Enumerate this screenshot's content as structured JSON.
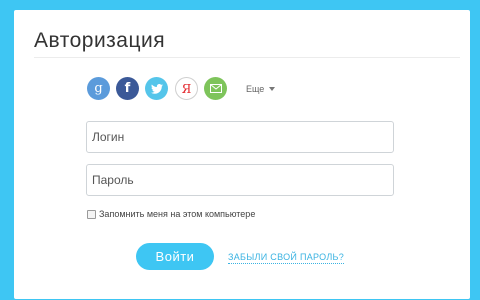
{
  "form": {
    "title": "Авторизация",
    "login_placeholder": "Логин",
    "password_placeholder": "Пароль",
    "remember_label": "Запомнить меня на этом компьютере",
    "submit_label": "Войти",
    "forgot_label": "ЗАБЫЛИ СВОЙ ПАРОЛЬ?"
  },
  "social": {
    "items": [
      {
        "name": "google",
        "glyph": "g",
        "icon": "google-icon",
        "color": "#5b9bdb"
      },
      {
        "name": "facebook",
        "glyph": "f",
        "icon": "facebook-icon",
        "color": "#3b5998"
      },
      {
        "name": "twitter",
        "glyph": "",
        "icon": "twitter-icon",
        "color": "#55c5ea"
      },
      {
        "name": "yandex",
        "glyph": "Я",
        "icon": "yandex-icon",
        "color": "#e3262b"
      },
      {
        "name": "mail",
        "glyph": "",
        "icon": "mail-icon",
        "color": "#7ec45b"
      }
    ],
    "more_label": "Еще"
  },
  "colors": {
    "background": "#3ec6f3",
    "accent": "#3ec6f3",
    "link": "#3ab3e2"
  }
}
